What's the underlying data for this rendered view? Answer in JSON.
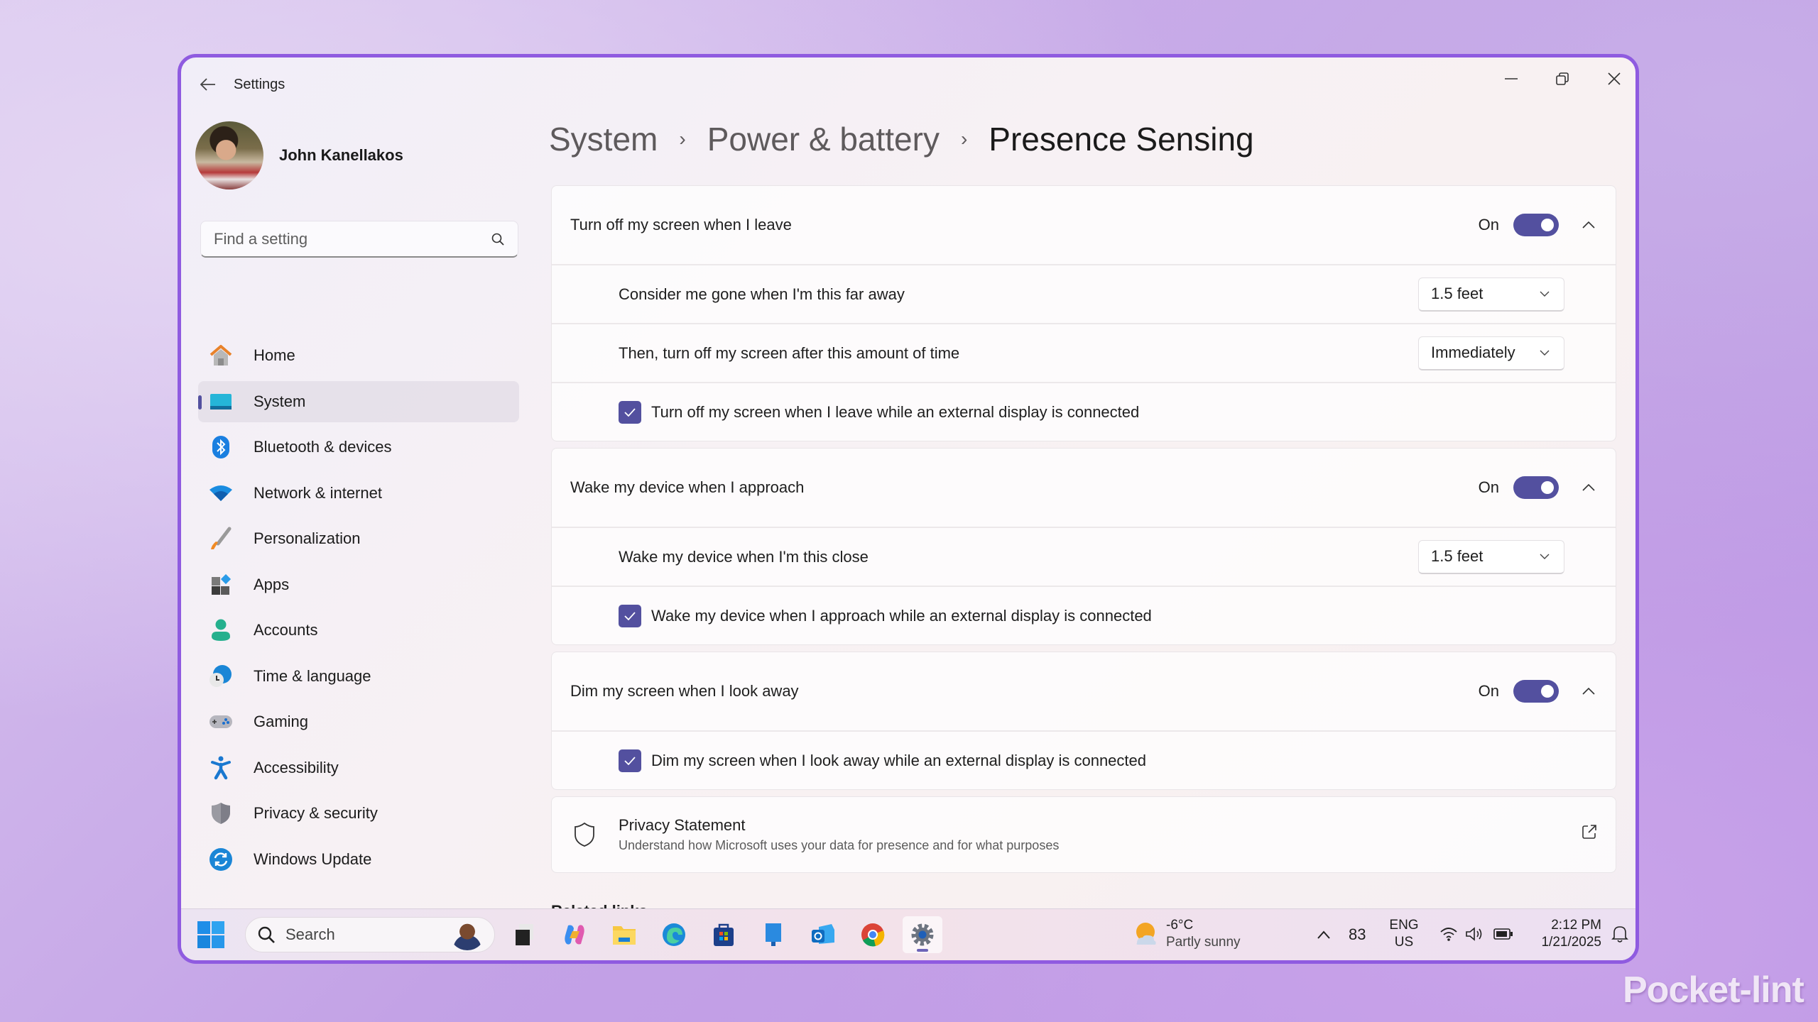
{
  "window": {
    "app_title": "Settings",
    "controls": {
      "minimize": "minimize-icon",
      "maximize": "restore-icon",
      "close": "close-icon"
    }
  },
  "profile": {
    "name": "John Kanellakos"
  },
  "search": {
    "placeholder": "Find a setting",
    "value": ""
  },
  "sidebar": {
    "items": [
      {
        "label": "Home",
        "icon": "home-icon"
      },
      {
        "label": "System",
        "icon": "system-icon",
        "active": true
      },
      {
        "label": "Bluetooth & devices",
        "icon": "bluetooth-icon"
      },
      {
        "label": "Network & internet",
        "icon": "wifi-icon"
      },
      {
        "label": "Personalization",
        "icon": "brush-icon"
      },
      {
        "label": "Apps",
        "icon": "apps-icon"
      },
      {
        "label": "Accounts",
        "icon": "account-icon"
      },
      {
        "label": "Time & language",
        "icon": "time-language-icon"
      },
      {
        "label": "Gaming",
        "icon": "gamepad-icon"
      },
      {
        "label": "Accessibility",
        "icon": "accessibility-icon"
      },
      {
        "label": "Privacy & security",
        "icon": "shield-icon"
      },
      {
        "label": "Windows Update",
        "icon": "update-icon"
      }
    ]
  },
  "breadcrumb": [
    "System",
    "Power & battery",
    "Presence Sensing"
  ],
  "sections": [
    {
      "title": "Turn off my screen when I leave",
      "state_label": "On",
      "enabled": true,
      "expanded": true,
      "rows": [
        {
          "type": "dropdown",
          "label": "Consider me gone when I'm this far away",
          "value": "1.5 feet"
        },
        {
          "type": "dropdown",
          "label": "Then, turn off my screen after this amount of time",
          "value": "Immediately"
        },
        {
          "type": "checkbox",
          "label": "Turn off my screen when I leave while an external display is connected",
          "checked": true
        }
      ]
    },
    {
      "title": "Wake my device when I approach",
      "state_label": "On",
      "enabled": true,
      "expanded": true,
      "rows": [
        {
          "type": "dropdown",
          "label": "Wake my device when I'm this close",
          "value": "1.5 feet"
        },
        {
          "type": "checkbox",
          "label": "Wake my device when I approach while an external display is connected",
          "checked": true
        }
      ]
    },
    {
      "title": "Dim my screen when I look away",
      "state_label": "On",
      "enabled": true,
      "expanded": true,
      "rows": [
        {
          "type": "checkbox",
          "label": "Dim my screen when I look away while an external display is connected",
          "checked": true
        }
      ]
    }
  ],
  "privacy": {
    "title": "Privacy Statement",
    "description": "Understand how Microsoft uses your data for presence and for what purposes"
  },
  "related_links_label": "Related links",
  "taskbar": {
    "search_label": "Search",
    "apps": [
      "task-view",
      "copilot",
      "file-explorer",
      "edge",
      "microsoft-store",
      "remote-desktop",
      "outlook",
      "chrome",
      "settings"
    ],
    "weather": {
      "temp": "-6°C",
      "condition": "Partly sunny"
    },
    "tray_count": "83",
    "language": {
      "line1": "ENG",
      "line2": "US"
    },
    "time": "2:12 PM",
    "date": "1/21/2025"
  },
  "colors": {
    "accent": "#53509f",
    "window_border": "#8f5be0"
  },
  "watermark": "Pocket-lint"
}
